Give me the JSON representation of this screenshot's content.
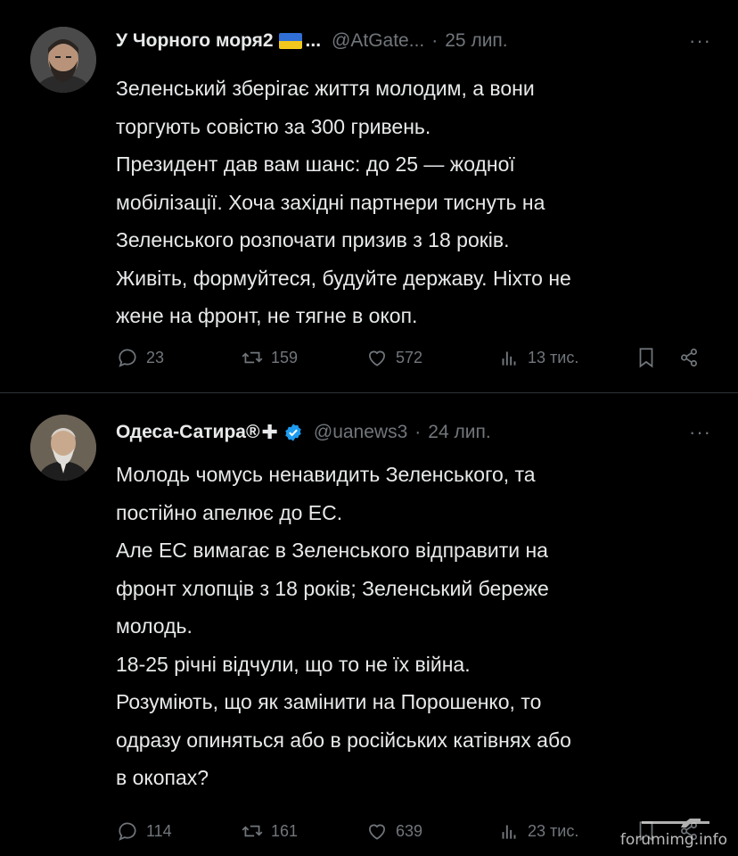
{
  "tweets": [
    {
      "display_name": "У Чорного моря2",
      "name_suffix": "...",
      "handle": "@AtGate...",
      "separator": "·",
      "date": "25 лип.",
      "more": "···",
      "avatar_icon": "bearded-man-avatar",
      "lines": [
        "Зеленський зберігає життя молодим, а вони",
        "торгують совістю за 300 гривень.",
        "Президент дав вам шанс: до 25 — жодної",
        "мобілізації. Хоча західні партнери тиснуть на",
        "Зеленського розпочати призив з 18 років.",
        "Живіть, формуйтеся, будуйте державу. Ніхто не",
        "жене на фронт, не тягне в окоп."
      ],
      "replies": "23",
      "retweets": "159",
      "likes": "572",
      "views": "13 тис."
    },
    {
      "display_name": "Одеса-Сатира®",
      "name_suffix": "✚",
      "handle": "@uanews3",
      "separator": "·",
      "date": "24 лип.",
      "more": "···",
      "avatar_icon": "old-man-portrait-avatar",
      "lines": [
        "Молодь чомусь ненавидить Зеленського, та",
        "постійно апелює до ЕС.",
        "Але ЕС вимагає в Зеленського відправити на",
        "фронт хлопців з 18 років; Зеленський береже",
        "молодь.",
        "18-25 річні відчули, що то не їх війна.",
        "Розуміють, що як замінити на Порошенко, то",
        "одразу опиняться або в російських катівнях або",
        "в окопах?"
      ],
      "replies": "114",
      "retweets": "161",
      "likes": "639",
      "views": "23 тис."
    }
  ],
  "watermark": "forumimg.info",
  "colors": {
    "background": "#000000",
    "text": "#e7e9ea",
    "muted": "#71767b",
    "divider": "#2f3336",
    "verified": "#1d9bf0",
    "flag_blue": "#2f6fd6",
    "flag_yellow": "#f2c81c"
  }
}
